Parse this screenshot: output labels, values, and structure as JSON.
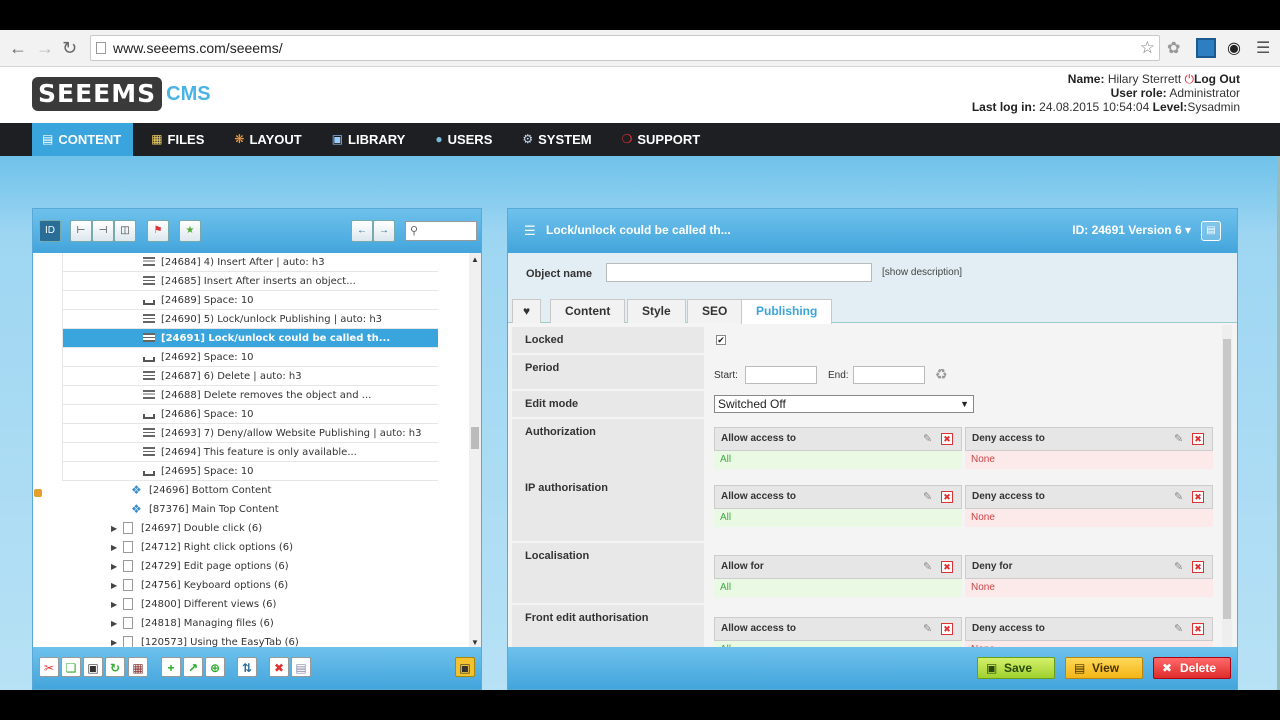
{
  "browser": {
    "url": "www.seeems.com/seeems/"
  },
  "header": {
    "logo_text": "SEEEMS",
    "logo_cms": "CMS",
    "name_label": "Name:",
    "name_value": "Hilary Sterrett",
    "logout": "Log Out",
    "role_label": "User role:",
    "role_value": "Administrator",
    "lastlog_label": "Last log in:",
    "lastlog_value": "24.08.2015 10:54:04",
    "level_label": "Level:",
    "level_value": "Sysadmin"
  },
  "nav": {
    "items": [
      {
        "label": "CONTENT",
        "icon": "page-icon"
      },
      {
        "label": "FILES",
        "icon": "files-icon"
      },
      {
        "label": "LAYOUT",
        "icon": "palette-icon"
      },
      {
        "label": "LIBRARY",
        "icon": "book-icon"
      },
      {
        "label": "USERS",
        "icon": "user-icon"
      },
      {
        "label": "SYSTEM",
        "icon": "gear-icon"
      },
      {
        "label": "SUPPORT",
        "icon": "lifebuoy-icon"
      }
    ]
  },
  "tree": {
    "id_button": "ID",
    "search_placeholder": "",
    "deep_rows": [
      {
        "text": "[24684] 4) Insert After | auto: h3",
        "icon": "lines"
      },
      {
        "text": "[24685] Insert After inserts an object...",
        "icon": "lines"
      },
      {
        "text": "[24689] Space: 10",
        "icon": "space"
      },
      {
        "text": "[24690] 5) Lock/unlock Publishing | auto: h3",
        "icon": "lines"
      },
      {
        "text": "[24691] Lock/unlock could be called th...",
        "icon": "lines",
        "selected": true
      },
      {
        "text": "[24692] Space: 10",
        "icon": "space"
      },
      {
        "text": "[24687] 6) Delete | auto: h3",
        "icon": "lines"
      },
      {
        "text": "[24688] Delete removes the object and ...",
        "icon": "lines"
      },
      {
        "text": "[24686] Space: 10",
        "icon": "space"
      },
      {
        "text": "[24693] 7) Deny/allow Website Publishing | auto: h3",
        "icon": "lines"
      },
      {
        "text": "[24694] This feature is only available...",
        "icon": "lines"
      },
      {
        "text": "[24695] Space: 10",
        "icon": "space"
      }
    ],
    "mid_rows": [
      {
        "text": "[24696] Bottom Content"
      },
      {
        "text": "[87376] Main Top Content"
      }
    ],
    "page_rows": [
      {
        "text": "[24697] Double click (6)"
      },
      {
        "text": "[24712] Right click options (6)"
      },
      {
        "text": "[24729] Edit page options (6)"
      },
      {
        "text": "[24756] Keyboard options (6)"
      },
      {
        "text": "[24800] Different views (6)"
      },
      {
        "text": "[24818] Managing files (6)"
      },
      {
        "text": "[120573] Using the EasyTab (6)"
      }
    ]
  },
  "editor": {
    "title": "Lock/unlock could be called th...",
    "id_version": "ID: 24691 Version 6",
    "object_name_label": "Object name",
    "object_name_value": "",
    "show_description": "[show description]",
    "tabs": [
      {
        "label": "♥",
        "name": "tab-favorite"
      },
      {
        "label": "Content",
        "name": "tab-content"
      },
      {
        "label": "Style",
        "name": "tab-style"
      },
      {
        "label": "SEO",
        "name": "tab-seo"
      },
      {
        "label": "Publishing",
        "name": "tab-publishing",
        "active": true
      }
    ],
    "locked_label": "Locked",
    "locked_value": "✔",
    "period_label": "Period",
    "start_label": "Start:",
    "end_label": "End:",
    "editmode_label": "Edit mode",
    "editmode_value": "Switched Off",
    "authorization_label": "Authorization",
    "ip_label": "IP authorisation",
    "localisation_label": "Localisation",
    "front_label": "Front edit authorisation",
    "allow_access": "Allow access to",
    "deny_access": "Deny access to",
    "allow_for": "Allow for",
    "deny_for": "Deny for",
    "all": "All",
    "none": "None",
    "save": "Save",
    "view": "View",
    "delete": "Delete"
  },
  "colors": {
    "accent": "#3aa5dd",
    "nav_bg": "#1d1f23",
    "save": "#9fd12e",
    "view": "#f2b516",
    "delete": "#de2b2b"
  }
}
